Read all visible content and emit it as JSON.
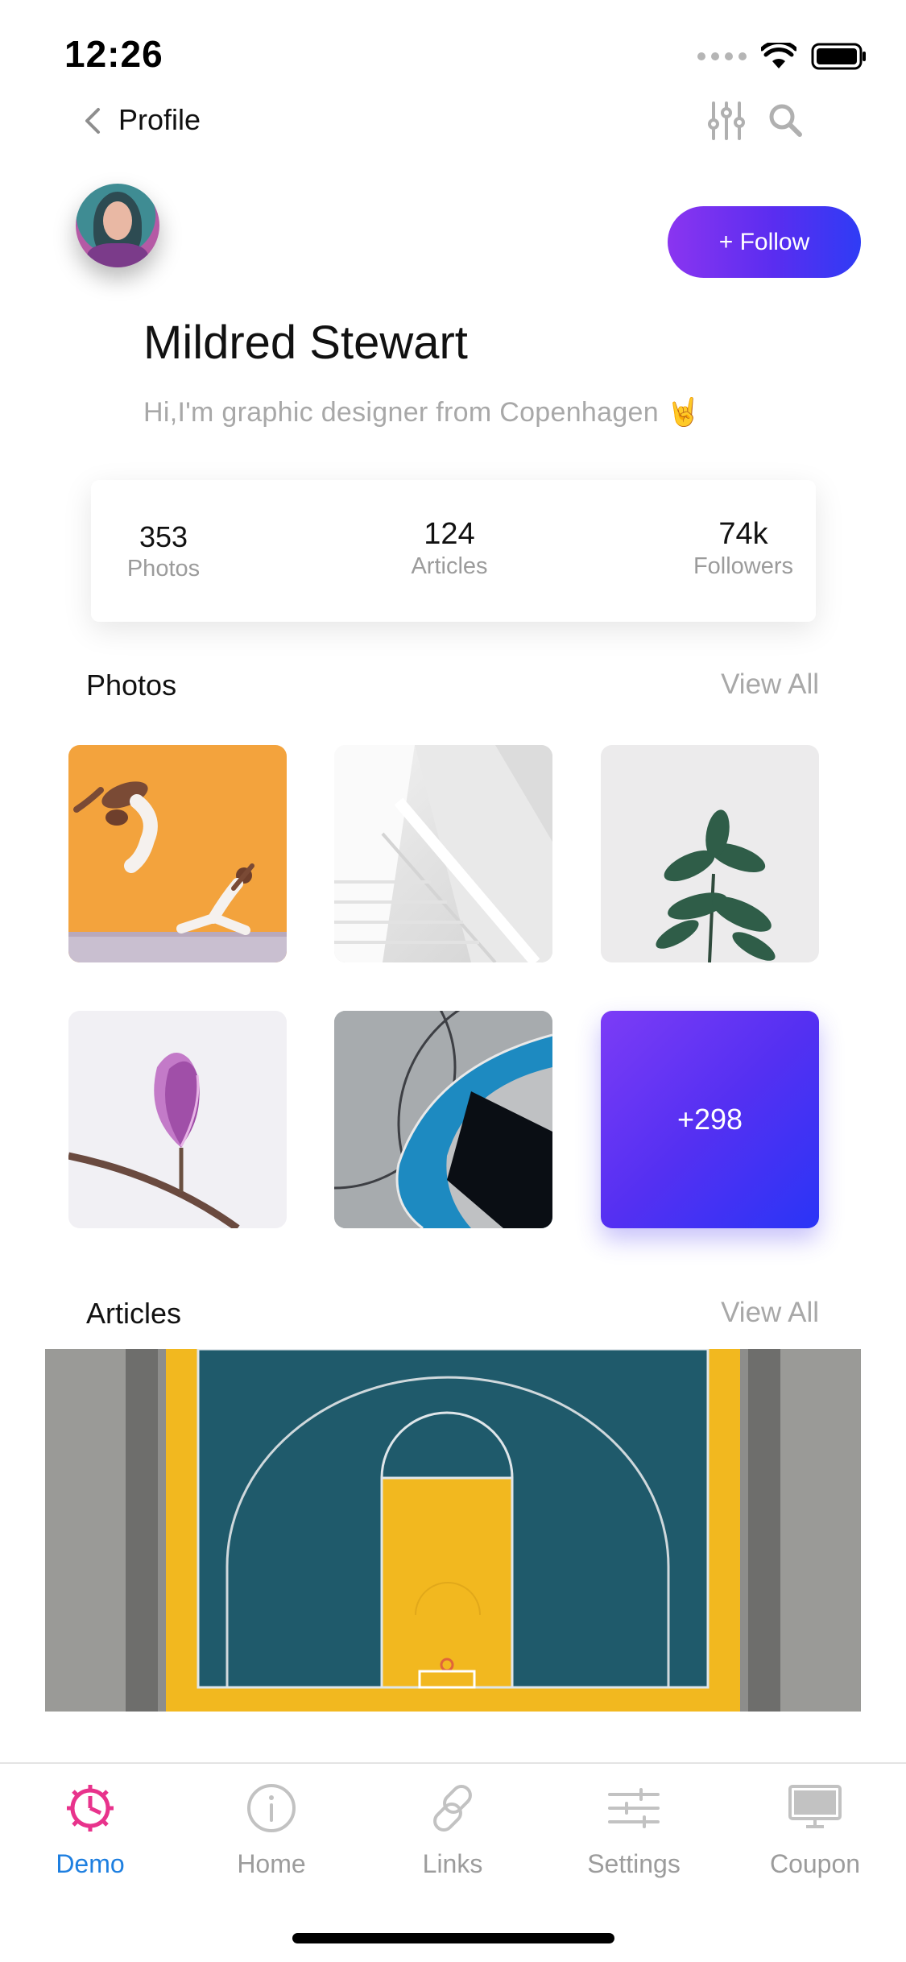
{
  "status_bar": {
    "time": "12:26"
  },
  "nav": {
    "title": "Profile"
  },
  "profile": {
    "name": "Mildred Stewart",
    "bio": "Hi,I'm graphic designer from Copenhagen 🤘",
    "follow_label": "+ Follow"
  },
  "stats": [
    {
      "value": "353",
      "label": "Photos"
    },
    {
      "value": "124",
      "label": "Articles"
    },
    {
      "value": "74k",
      "label": "Followers"
    }
  ],
  "photos": {
    "title": "Photos",
    "view_all": "View All",
    "more_count": "+298"
  },
  "articles": {
    "title": "Articles",
    "view_all": "View All"
  },
  "tabs": [
    {
      "label": "Demo",
      "icon": "gear-icon",
      "active": true
    },
    {
      "label": "Home",
      "icon": "info-icon",
      "active": false
    },
    {
      "label": "Links",
      "icon": "link-icon",
      "active": false
    },
    {
      "label": "Settings",
      "icon": "sliders-icon",
      "active": false
    },
    {
      "label": "Coupon",
      "icon": "monitor-icon",
      "active": false
    }
  ],
  "colors": {
    "accent_gradient_start": "#8a35f0",
    "accent_gradient_end": "#2f3cf5",
    "active_tab": "#1e7fe0",
    "demo_icon": "#e8338c",
    "muted_text": "#a8a8a8"
  }
}
